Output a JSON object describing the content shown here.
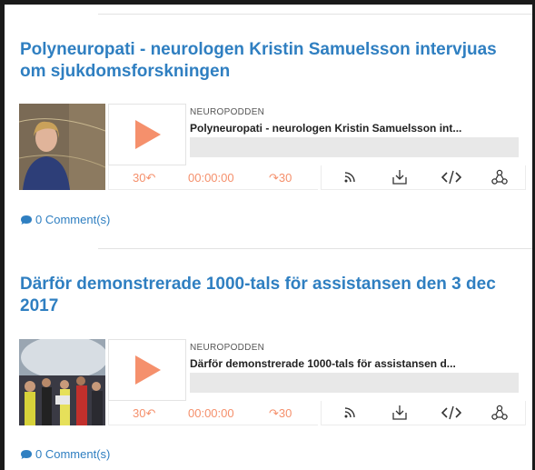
{
  "posts": [
    {
      "title": "Polyneuropati - neurologen Kristin Samuelsson intervjuas om sjukdomsforskningen",
      "player": {
        "podcast_name": "NEUROPODDEN",
        "episode_title": "Polyneuropati - neurologen Kristin Samuelsson int...",
        "skip_back": "30↶",
        "time": "00:00:00",
        "skip_forward": "↷30"
      },
      "comments": "0 Comment(s)"
    },
    {
      "title": "Därför demonstrerade 1000-tals för assistansen den 3 dec 2017",
      "player": {
        "podcast_name": "NEUROPODDEN",
        "episode_title": "Därför demonstrerade 1000-tals för assistansen d...",
        "skip_back": "30↶",
        "time": "00:00:00",
        "skip_forward": "↷30"
      },
      "comments": "0 Comment(s)"
    }
  ],
  "icons": {
    "subscribe": "rss-icon",
    "download": "download-icon",
    "embed": "code-icon",
    "share": "share-icon",
    "comment": "comment-bubble-icon"
  },
  "colors": {
    "link": "#2f7fc1",
    "player_accent": "#f5906c"
  }
}
